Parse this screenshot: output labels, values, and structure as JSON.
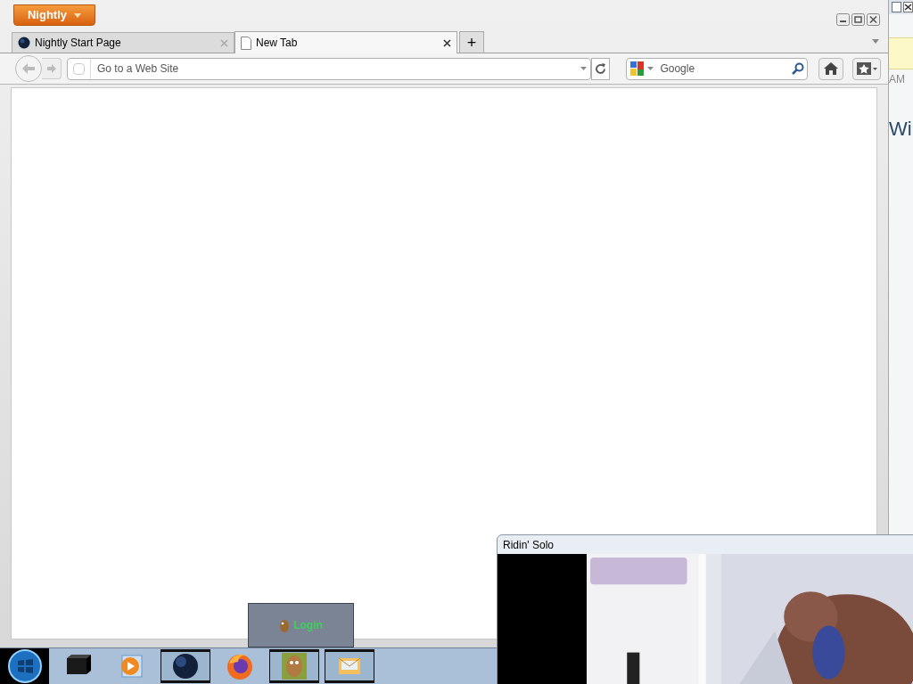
{
  "browser": {
    "app_button": "Nightly",
    "tabs": [
      {
        "title": "Nightly Start Page",
        "selected": false,
        "kind": "globe"
      },
      {
        "title": "New Tab",
        "selected": true,
        "kind": "page"
      }
    ],
    "new_tab": "+",
    "address_placeholder": "Go to a Web Site",
    "search_placeholder": "Google"
  },
  "background_window": {
    "texts": [
      "AM",
      "Wi"
    ]
  },
  "tooltip": {
    "label": "Login"
  },
  "video_window": {
    "title": "Ridin' Solo"
  },
  "taskbar": {
    "items": [
      {
        "kind": "cube",
        "active": false
      },
      {
        "kind": "media",
        "active": false
      },
      {
        "kind": "globe",
        "active": true
      },
      {
        "kind": "firefox",
        "active": false
      },
      {
        "kind": "gopher",
        "active": true
      },
      {
        "kind": "mail",
        "active": true
      }
    ]
  }
}
